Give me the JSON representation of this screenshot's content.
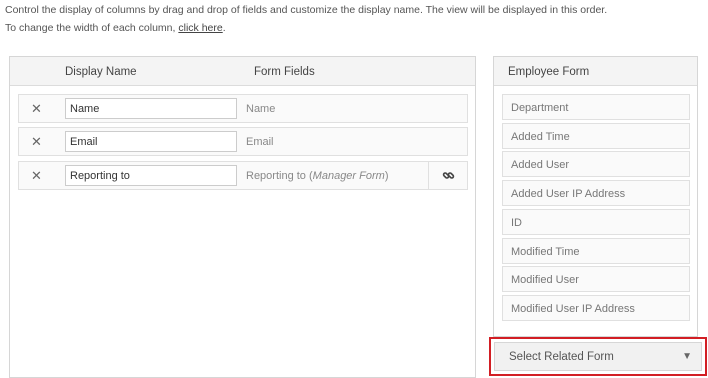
{
  "intro": {
    "line1": "Control the display of columns by drag and drop of fields and customize the display name. The view will be displayed in this order.",
    "line2_prefix": "To change the width of each column, ",
    "line2_link": "click here",
    "line2_suffix": "."
  },
  "columns_panel": {
    "header_display_name": "Display Name",
    "header_form_fields": "Form Fields",
    "rows": [
      {
        "display_name": "Name",
        "field": "Name",
        "related": ""
      },
      {
        "display_name": "Email",
        "field": "Email",
        "related": ""
      },
      {
        "display_name": "Reporting to",
        "field": "Reporting to",
        "related": "Manager Form"
      }
    ],
    "remove_icon": "close-icon",
    "link_icon": "link-icon"
  },
  "form_panel": {
    "title": "Employee Form",
    "fields": [
      "Department",
      "Added Time",
      "Added User",
      "Added User IP Address",
      "ID",
      "Modified Time",
      "Modified User",
      "Modified User IP Address"
    ]
  },
  "related_select": {
    "label": "Select Related Form",
    "highlight_color": "#d21e24"
  }
}
